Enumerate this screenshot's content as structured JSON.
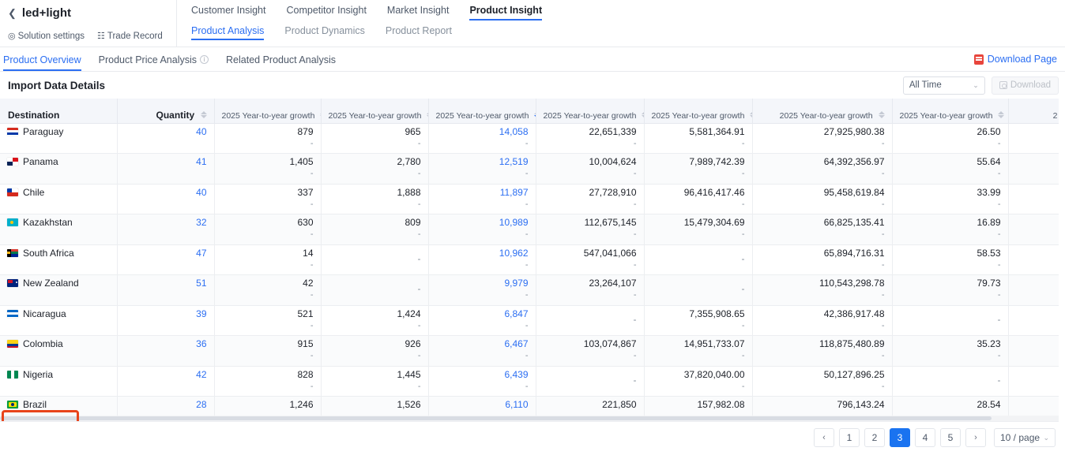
{
  "solution": {
    "back_icon": "chevron-left-icon",
    "name": "led+light",
    "links": [
      {
        "icon": "settings-gear-icon",
        "glyph": "◎",
        "label": "Solution settings"
      },
      {
        "icon": "document-icon",
        "glyph": "☷",
        "label": "Trade Record"
      }
    ]
  },
  "primary_tabs": [
    {
      "label": "Customer Insight",
      "active": false
    },
    {
      "label": "Competitor Insight",
      "active": false
    },
    {
      "label": "Market Insight",
      "active": false
    },
    {
      "label": "Product Insight",
      "active": true
    }
  ],
  "secondary_tabs": [
    {
      "label": "Product Analysis",
      "active": true
    },
    {
      "label": "Product Dynamics",
      "active": false
    },
    {
      "label": "Product Report",
      "active": false
    }
  ],
  "subnav": {
    "tabs": [
      {
        "label": "Product Overview",
        "active": true,
        "info": false
      },
      {
        "label": "Product Price Analysis",
        "active": false,
        "info": true
      },
      {
        "label": "Related Product Analysis",
        "active": false,
        "info": false
      }
    ],
    "download_page": {
      "label": "Download Page",
      "icon": "pdf-icon"
    }
  },
  "panel": {
    "title": "Import Data Details",
    "time_filter": {
      "value": "All Time",
      "caret": "⌄"
    },
    "download_button": {
      "label": "Download",
      "icon": "download-icon",
      "disabled": true
    }
  },
  "table": {
    "columns": [
      {
        "key": "destination",
        "header": "Destination",
        "sub": "",
        "align": "left",
        "sortable": false
      },
      {
        "key": "quantity",
        "header": "Quantity",
        "sub": "",
        "align": "right",
        "sortable": true
      },
      {
        "key": "c2",
        "header": "",
        "sub": "2025 Year-to-year growth",
        "align": "right",
        "sortable": true
      },
      {
        "key": "c3",
        "header": "",
        "sub": "2025 Year-to-year growth",
        "align": "right",
        "sortable": true
      },
      {
        "key": "c4",
        "header": "",
        "sub": "2025 Year-to-year growth",
        "align": "right",
        "sortable": true,
        "sorted": true
      },
      {
        "key": "c5",
        "header": "",
        "sub": "2025 Year-to-year growth",
        "align": "right",
        "sortable": true
      },
      {
        "key": "c6",
        "header": "",
        "sub": "2025 Year-to-year growth",
        "align": "right",
        "sortable": true
      },
      {
        "key": "c7",
        "header": "",
        "sub": "2025 Year-to-year growth",
        "align": "right",
        "sortable": true
      },
      {
        "key": "c8",
        "header": "",
        "sub": "2025 Year-to-year growth",
        "align": "right",
        "sortable": true
      },
      {
        "key": "c9",
        "header": "",
        "sub": "2",
        "align": "right",
        "sortable": false
      }
    ],
    "sub_value": "-",
    "rows": [
      {
        "country": "Paraguay",
        "flag": "flag-paraguay",
        "quantity": "40",
        "cells": [
          "879",
          "965",
          "14,058",
          "22,651,339",
          "5,581,364.91",
          "27,925,980.38",
          "26.50",
          ""
        ]
      },
      {
        "country": "Panama",
        "flag": "flag-panama",
        "quantity": "41",
        "cells": [
          "1,405",
          "2,780",
          "12,519",
          "10,004,624",
          "7,989,742.39",
          "64,392,356.97",
          "55.64",
          ""
        ]
      },
      {
        "country": "Chile",
        "flag": "flag-chile",
        "quantity": "40",
        "cells": [
          "337",
          "1,888",
          "11,897",
          "27,728,910",
          "96,416,417.46",
          "95,458,619.84",
          "33.99",
          ""
        ]
      },
      {
        "country": "Kazakhstan",
        "flag": "flag-kazakhstan",
        "quantity": "32",
        "cells": [
          "630",
          "809",
          "10,989",
          "112,675,145",
          "15,479,304.69",
          "66,825,135.41",
          "16.89",
          ""
        ]
      },
      {
        "country": "South Africa",
        "flag": "flag-southafrica",
        "quantity": "47",
        "cells": [
          "14",
          "-",
          "10,962",
          "547,041,066",
          "-",
          "65,894,716.31",
          "58.53",
          ""
        ]
      },
      {
        "country": "New Zealand",
        "flag": "flag-newzealand",
        "quantity": "51",
        "cells": [
          "42",
          "-",
          "9,979",
          "23,264,107",
          "-",
          "110,543,298.78",
          "79.73",
          ""
        ]
      },
      {
        "country": "Nicaragua",
        "flag": "flag-nicaragua",
        "quantity": "39",
        "cells": [
          "521",
          "1,424",
          "6,847",
          "-",
          "7,355,908.65",
          "42,386,917.48",
          "-",
          ""
        ]
      },
      {
        "country": "Colombia",
        "flag": "flag-colombia",
        "quantity": "36",
        "cells": [
          "915",
          "926",
          "6,467",
          "103,074,867",
          "14,951,733.07",
          "118,875,480.89",
          "35.23",
          ""
        ]
      },
      {
        "country": "Nigeria",
        "flag": "flag-nigeria",
        "quantity": "42",
        "cells": [
          "828",
          "1,445",
          "6,439",
          "-",
          "37,820,040.00",
          "50,127,896.25",
          "-",
          ""
        ]
      },
      {
        "country": "Brazil",
        "flag": "flag-brazil",
        "quantity": "28",
        "highlighted": true,
        "cells": [
          "1,246",
          "1,526",
          "6,110",
          "221,850",
          "157,982.08",
          "796,143.24",
          "28.54",
          ""
        ]
      }
    ]
  },
  "pagination": {
    "prev": "‹",
    "next": "›",
    "pages": [
      "1",
      "2",
      "3",
      "4",
      "5"
    ],
    "current": "3",
    "page_size": "10 / page",
    "caret": "⌄"
  },
  "colors": {
    "accent": "#2b6ef2",
    "active_page": "#1a73f0",
    "highlight_border": "#e8441c",
    "link": "#2b6ef2"
  }
}
